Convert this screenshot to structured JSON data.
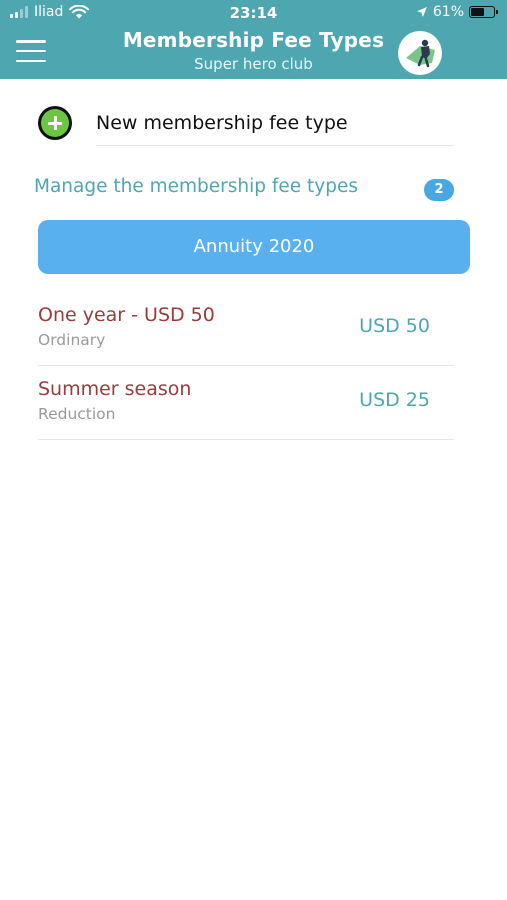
{
  "status_bar": {
    "carrier": "Iliad",
    "time": "23:14",
    "battery": "61%",
    "battery_level": 0.61
  },
  "header": {
    "title": "Membership Fee Types",
    "subtitle": "Super hero club",
    "menu_icon": "hamburger-menu-icon",
    "avatar_icon": "superhero-avatar-icon",
    "background_color": "#4ea7b0"
  },
  "new_fee": {
    "label": "New membership fee type",
    "icon": "add-circle-icon"
  },
  "manage": {
    "label": "Manage the membership fee types",
    "count": "2"
  },
  "season": {
    "label": "Annuity 2020"
  },
  "fees": [
    {
      "name": "One year - USD 50",
      "type": "Ordinary",
      "amount": "USD 50"
    },
    {
      "name": "Summer season",
      "type": "Reduction",
      "amount": "USD 25"
    }
  ],
  "colors": {
    "accent": "#4ea7b0",
    "button": "#58b1ee",
    "fee_name": "#9b3b3b",
    "add": "#6cc644"
  }
}
